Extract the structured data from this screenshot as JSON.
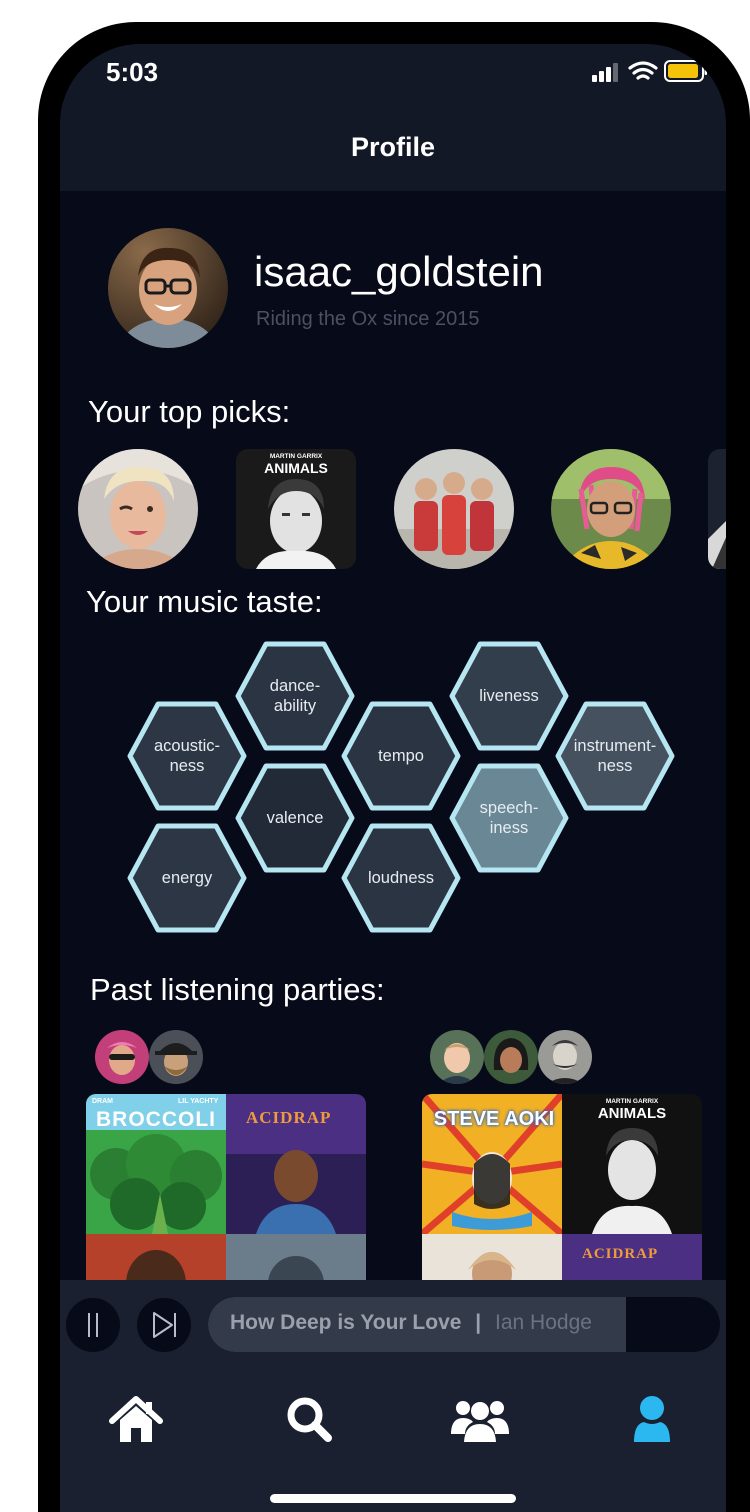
{
  "status_bar": {
    "time": "5:03"
  },
  "header": {
    "title": "Profile"
  },
  "profile": {
    "username": "isaac_goldstein",
    "tagline": "Riding the Ox since 2015"
  },
  "sections": {
    "top_picks": "Your top picks:",
    "music_taste": "Your music taste:",
    "past_parties": "Past listening parties:"
  },
  "top_picks": [
    {
      "type": "artist",
      "cover_text": ""
    },
    {
      "type": "album",
      "cover_top": "MARTIN GARRIX",
      "cover_text": "ANIMALS"
    },
    {
      "type": "artist",
      "cover_text": ""
    },
    {
      "type": "artist",
      "cover_text": ""
    }
  ],
  "music_taste": [
    {
      "label": "dance-\nability",
      "fill": "#2a3442"
    },
    {
      "label": "liveness",
      "fill": "#333e4c"
    },
    {
      "label": "acoustic-\nness",
      "fill": "#2c3644"
    },
    {
      "label": "tempo",
      "fill": "#2a3442"
    },
    {
      "label": "instrument-\nness",
      "fill": "#45515e"
    },
    {
      "label": "valence",
      "fill": "#222a37"
    },
    {
      "label": "speech-\niness",
      "fill": "#6a8796"
    },
    {
      "label": "energy",
      "fill": "#2c3644"
    },
    {
      "label": "loudness",
      "fill": "#2a3442"
    }
  ],
  "parties": [
    {
      "covers": [
        {
          "top_left": "DRAM",
          "top_right": "LIL YACHTY",
          "title": "BROCCOLI"
        },
        {
          "title": "ACIDRAP"
        }
      ]
    },
    {
      "covers": [
        {
          "title": "STEVE AOKI"
        },
        {
          "top": "MARTIN GARRIX",
          "title": "ANIMALS"
        },
        {
          "title": "ACIDRAP"
        }
      ]
    }
  ],
  "player": {
    "title": "How Deep is Your Love",
    "separator": "|",
    "artist": "Ian Hodge"
  },
  "colors": {
    "accent": "#2bb7f0",
    "hex_border": "#b6e6f2",
    "background": "#070a18"
  },
  "tabs": [
    {
      "icon": "home-icon"
    },
    {
      "icon": "search-icon"
    },
    {
      "icon": "group-icon"
    },
    {
      "icon": "user-icon",
      "active": true
    }
  ]
}
